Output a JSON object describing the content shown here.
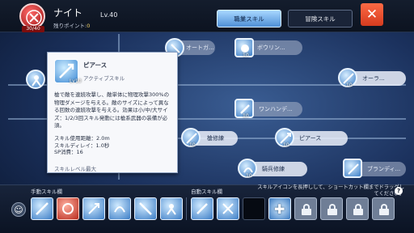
{
  "header": {
    "sp_badge": "30/40",
    "class_name": "ナイト",
    "remaining_label": "残りポイント:",
    "remaining_value": "0",
    "level": "Lv.40",
    "tabs": [
      {
        "label": "職業スキル",
        "active": true
      },
      {
        "label": "冒険スキル",
        "active": false
      }
    ],
    "close_label": "✕"
  },
  "tree": {
    "nodes": [
      {
        "label": "オートガ...",
        "level": ""
      },
      {
        "label": "ボウリン...",
        "level": "10"
      },
      {
        "label": "オーラ...",
        "level": "10"
      },
      {
        "label": "ワンハンデ...",
        "level": "10"
      },
      {
        "label": "槍修練",
        "level": "10"
      },
      {
        "label": "ピアース",
        "level": "10"
      },
      {
        "label": "騎兵修練",
        "level": "10"
      },
      {
        "label": "ブランディ...",
        "level": ""
      }
    ]
  },
  "tooltip": {
    "name": "ピアース",
    "level": "Lv10",
    "type": "アクティブスキル",
    "description": "槍で敵を連続攻撃し、敵単体に物理攻撃300%の物理ダメージを与える。敵のサイズによって異なる回数の連続攻撃を与える。効果は小/中/大サイズ：1/2/3回スキル発動には槍系武器の装備が必須。",
    "stats": [
      "スキル使用距離：2.0m",
      "スキルディレイ：1.0秒",
      "SP消費：16"
    ],
    "max_label": "スキルレベル最大"
  },
  "bottom": {
    "manual_label": "手動スキル欄",
    "auto_label": "自動スキル欄",
    "hint": "スキルアイコンを長押しして、ショートカット欄までドラッグしてください。",
    "help": "?",
    "manual_slots": [
      {
        "name": "blue-skill"
      },
      {
        "name": "red-skill"
      },
      {
        "name": "blue-skill"
      },
      {
        "name": "blue-skill"
      },
      {
        "name": "blue-skill"
      },
      {
        "name": "blue-skill"
      }
    ],
    "auto_slots": [
      {
        "kind": "skill"
      },
      {
        "kind": "skill"
      },
      {
        "kind": "empty"
      },
      {
        "kind": "plus"
      },
      {
        "kind": "lock"
      },
      {
        "kind": "lock"
      },
      {
        "kind": "lock"
      },
      {
        "kind": "lock"
      }
    ]
  }
}
